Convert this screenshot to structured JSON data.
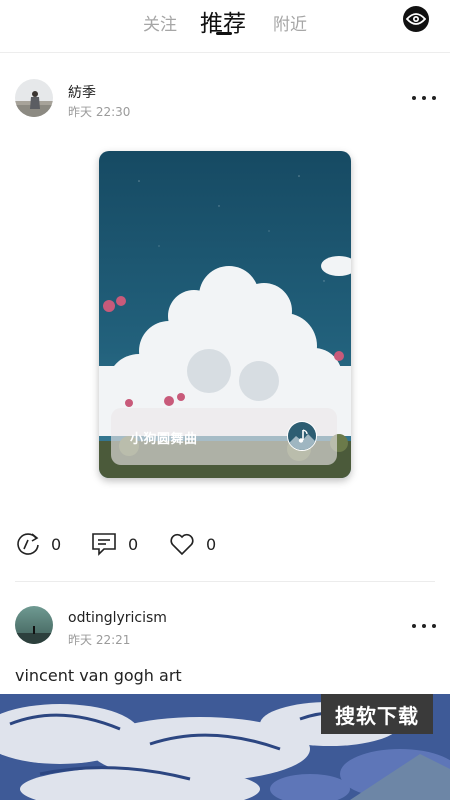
{
  "nav": {
    "tabs": [
      {
        "label": "关注",
        "active": false
      },
      {
        "label": "推荐",
        "active": true
      },
      {
        "label": "附近",
        "active": false
      }
    ],
    "right_icon": "eye-icon"
  },
  "posts": [
    {
      "username": "紡季",
      "time": "昨天 22:30",
      "card": {
        "song_title": "小狗圆舞曲",
        "icon": "music-note-icon"
      },
      "actions": {
        "reposts": "0",
        "comments": "0",
        "likes": "0"
      }
    },
    {
      "username": "odtinglyricism",
      "time": "昨天 22:21",
      "caption": "vincent van gogh art",
      "watermark": "搜软下载"
    }
  ],
  "colors": {
    "active_tab": "#111111",
    "inactive_tab": "#a6a6a6",
    "time_text": "#9b9b9b",
    "sky": "#1f5f7a"
  }
}
